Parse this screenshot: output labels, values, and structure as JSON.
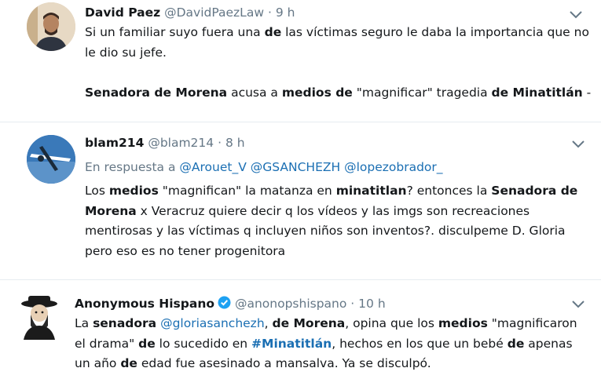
{
  "tweets": [
    {
      "name": "David Paez",
      "handle": "@DavidPaezLaw",
      "time": "9 h",
      "paragraphs": [
        [
          {
            "t": "Si un familiar suyo fuera una "
          },
          {
            "t": "de",
            "b": true
          },
          {
            "t": " las víctimas seguro le daba la importancia que no le dio su jefe."
          }
        ],
        [
          {
            "t": "Senadora de Morena",
            "b": true
          },
          {
            "t": " acusa a "
          },
          {
            "t": "medios de",
            "b": true
          },
          {
            "t": " \"magnificar\" tragedia "
          },
          {
            "t": "de Minatitlán",
            "b": true
          },
          {
            "t": " -"
          }
        ]
      ]
    },
    {
      "name": "blam214",
      "handle": "@blam214",
      "time": "8 h",
      "reply_prefix": "En respuesta a",
      "reply_to": [
        "@Arouet_V",
        "@GSANCHEZH",
        "@lopezobrador_"
      ],
      "paragraphs": [
        [
          {
            "t": "Los "
          },
          {
            "t": "medios",
            "b": true
          },
          {
            "t": " \"magnifican\" la matanza en "
          },
          {
            "t": "minatitlan",
            "b": true
          },
          {
            "t": "? entonces la "
          },
          {
            "t": "Senadora de Morena",
            "b": true
          },
          {
            "t": " x Veracruz quiere decir q los vídeos y las imgs  son recreaciones mentirosas y las víctimas q incluyen niños son inventos?. disculpeme D. Gloria pero eso es no tener progenitora"
          }
        ]
      ]
    },
    {
      "name": "Anonymous Hispano",
      "handle": "@anonopshispano",
      "time": "10 h",
      "verified": true,
      "paragraphs": [
        [
          {
            "t": "La "
          },
          {
            "t": "senadora",
            "b": true
          },
          {
            "t": " "
          },
          {
            "t": "@gloriasanchezh",
            "link": true
          },
          {
            "t": ", "
          },
          {
            "t": "de Morena",
            "b": true
          },
          {
            "t": ", opina que los "
          },
          {
            "t": "medios",
            "b": true
          },
          {
            "t": " \"magnificaron el drama\" "
          },
          {
            "t": "de",
            "b": true
          },
          {
            "t": " lo sucedido en "
          },
          {
            "t": "#Minatitlán",
            "link": true,
            "b": true
          },
          {
            "t": ", hechos en los que un bebé "
          },
          {
            "t": "de",
            "b": true
          },
          {
            "t": " apenas un año "
          },
          {
            "t": "de",
            "b": true
          },
          {
            "t": " edad fue asesinado a mansalva. Ya se disculpó."
          }
        ]
      ]
    }
  ],
  "dot": "·",
  "icons": {
    "verified": "verified-badge-icon",
    "caret": "chevron-down-icon"
  },
  "colors": {
    "text": "#14171a",
    "muted": "#657786",
    "link": "#1b6fb3",
    "separator": "#e6ecf0"
  }
}
